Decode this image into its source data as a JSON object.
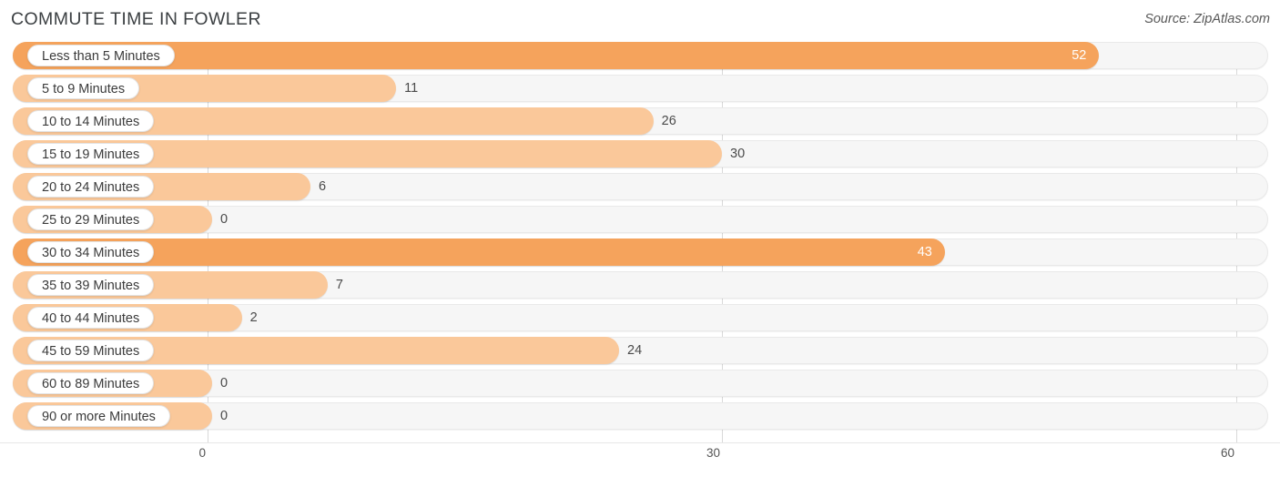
{
  "header": {
    "title": "COMMUTE TIME IN FOWLER",
    "source": "Source: ZipAtlas.com"
  },
  "colors": {
    "bar_high": "#f5a35c",
    "bar_low": "#fac89a",
    "track": "#f6f6f6",
    "gridline": "#d9d9d9",
    "value_inside": "#ffffff",
    "value_outside": "#4a4a4a"
  },
  "chart_data": {
    "type": "bar",
    "orientation": "horizontal",
    "title": "COMMUTE TIME IN FOWLER",
    "xlabel": "",
    "ylabel": "",
    "xlim": [
      0,
      60
    ],
    "grid": true,
    "legend": "none",
    "xticks": [
      "0",
      "30",
      "60"
    ],
    "xtick_values": [
      0,
      30,
      60
    ],
    "categories": [
      "Less than 5 Minutes",
      "5 to 9 Minutes",
      "10 to 14 Minutes",
      "15 to 19 Minutes",
      "20 to 24 Minutes",
      "25 to 29 Minutes",
      "30 to 34 Minutes",
      "35 to 39 Minutes",
      "40 to 44 Minutes",
      "45 to 59 Minutes",
      "60 to 89 Minutes",
      "90 or more Minutes"
    ],
    "values": [
      52,
      11,
      26,
      30,
      6,
      0,
      43,
      7,
      2,
      24,
      0,
      0
    ],
    "value_labels": [
      "52",
      "11",
      "26",
      "30",
      "6",
      "0",
      "43",
      "7",
      "2",
      "24",
      "0",
      "0"
    ]
  },
  "rows": [
    {
      "label": "Less than 5 Minutes",
      "value": 52,
      "value_label": "52",
      "shade": "high",
      "label_inside": true
    },
    {
      "label": "5 to 9 Minutes",
      "value": 11,
      "value_label": "11",
      "shade": "low",
      "label_inside": false
    },
    {
      "label": "10 to 14 Minutes",
      "value": 26,
      "value_label": "26",
      "shade": "low",
      "label_inside": false
    },
    {
      "label": "15 to 19 Minutes",
      "value": 30,
      "value_label": "30",
      "shade": "low",
      "label_inside": false
    },
    {
      "label": "20 to 24 Minutes",
      "value": 6,
      "value_label": "6",
      "shade": "low",
      "label_inside": false
    },
    {
      "label": "25 to 29 Minutes",
      "value": 0,
      "value_label": "0",
      "shade": "low",
      "label_inside": false
    },
    {
      "label": "30 to 34 Minutes",
      "value": 43,
      "value_label": "43",
      "shade": "high",
      "label_inside": true
    },
    {
      "label": "35 to 39 Minutes",
      "value": 7,
      "value_label": "7",
      "shade": "low",
      "label_inside": false
    },
    {
      "label": "40 to 44 Minutes",
      "value": 2,
      "value_label": "2",
      "shade": "low",
      "label_inside": false
    },
    {
      "label": "45 to 59 Minutes",
      "value": 24,
      "value_label": "24",
      "shade": "low",
      "label_inside": false
    },
    {
      "label": "60 to 89 Minutes",
      "value": 0,
      "value_label": "0",
      "shade": "low",
      "label_inside": false
    },
    {
      "label": "90 or more Minutes",
      "value": 0,
      "value_label": "0",
      "shade": "low",
      "label_inside": false
    }
  ],
  "axis": {
    "ticks": [
      {
        "label": "0",
        "value": 0
      },
      {
        "label": "30",
        "value": 30
      },
      {
        "label": "60",
        "value": 60
      }
    ]
  }
}
